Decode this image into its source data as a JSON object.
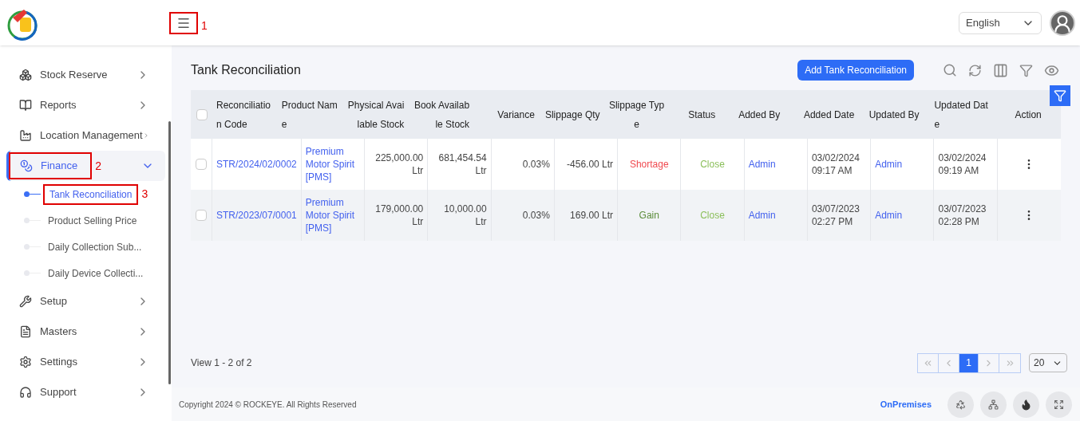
{
  "header": {
    "menu_annotation": "1",
    "language": "English"
  },
  "sidebar": {
    "items": [
      {
        "label": "Stock Reserve",
        "expanded": false,
        "selected": false
      },
      {
        "label": "Reports",
        "expanded": false,
        "selected": false
      },
      {
        "label": "Location Management",
        "expanded": false,
        "selected": false
      },
      {
        "label": "Finance",
        "expanded": true,
        "selected": true,
        "annotation": "2",
        "children": [
          {
            "label": "Tank Reconciliation",
            "selected": true,
            "annotation": "3"
          },
          {
            "label": "Product Selling Price",
            "selected": false
          },
          {
            "label": "Daily Collection Sub...",
            "selected": false
          },
          {
            "label": "Daily Device Collecti...",
            "selected": false
          }
        ]
      },
      {
        "label": "Setup",
        "expanded": false,
        "selected": false
      },
      {
        "label": "Masters",
        "expanded": false,
        "selected": false
      },
      {
        "label": "Settings",
        "expanded": false,
        "selected": false
      },
      {
        "label": "Support",
        "expanded": false,
        "selected": false
      }
    ]
  },
  "page": {
    "title": "Tank Reconciliation",
    "add_button": "Add Tank Reconciliation"
  },
  "table": {
    "columns": [
      {
        "label": "Reconciliation Code"
      },
      {
        "label": "Product Name"
      },
      {
        "label": "Physical Available Stock"
      },
      {
        "label": "Book Available Stock"
      },
      {
        "label": "Variance"
      },
      {
        "label": "Slippage Qty"
      },
      {
        "label": "Slippage Type"
      },
      {
        "label": "Status"
      },
      {
        "label": "Added By"
      },
      {
        "label": "Added Date"
      },
      {
        "label": "Updated By"
      },
      {
        "label": "Updated Date"
      },
      {
        "label": "Action"
      }
    ],
    "all_checked": false,
    "rows": [
      {
        "checked": false,
        "cells": [
          {
            "text": "STR/2024/02/0002",
            "kind": "link"
          },
          {
            "text": "Premium Motor Spirit [PMS]",
            "kind": "link"
          },
          {
            "text": "225,000.00 Ltr",
            "kind": "plain"
          },
          {
            "text": "681,454.54 Ltr",
            "kind": "plain"
          },
          {
            "text": "0.03%",
            "kind": "plain"
          },
          {
            "text": "-456.00 Ltr",
            "kind": "plain"
          },
          {
            "text": "Shortage",
            "kind": "shortage"
          },
          {
            "text": "Close",
            "kind": "status"
          },
          {
            "text": "Admin",
            "kind": "link"
          },
          {
            "text": "03/02/2024 09:17 AM",
            "kind": "plain"
          },
          {
            "text": "Admin",
            "kind": "link"
          },
          {
            "text": "03/02/2024 09:19 AM",
            "kind": "plain"
          }
        ]
      },
      {
        "checked": false,
        "cells": [
          {
            "text": "STR/2023/07/0001",
            "kind": "link"
          },
          {
            "text": "Premium Motor Spirit [PMS]",
            "kind": "link"
          },
          {
            "text": "179,000.00 Ltr",
            "kind": "plain"
          },
          {
            "text": "10,000.00 Ltr",
            "kind": "plain"
          },
          {
            "text": "0.03%",
            "kind": "plain"
          },
          {
            "text": "169.00 Ltr",
            "kind": "plain"
          },
          {
            "text": "Gain",
            "kind": "gain"
          },
          {
            "text": "Close",
            "kind": "status"
          },
          {
            "text": "Admin",
            "kind": "link"
          },
          {
            "text": "03/07/2023 02:27 PM",
            "kind": "plain"
          },
          {
            "text": "Admin",
            "kind": "link"
          },
          {
            "text": "03/07/2023 02:28 PM",
            "kind": "plain"
          }
        ]
      }
    ]
  },
  "pagination": {
    "summary": "View 1 - 2 of 2",
    "pages": [
      {
        "label": "1",
        "selected": true
      }
    ],
    "page_size": "20"
  },
  "footer": {
    "copyright": "Copyright 2024 © ROCKEYE. All Rights Reserved",
    "mode": "OnPremises"
  }
}
